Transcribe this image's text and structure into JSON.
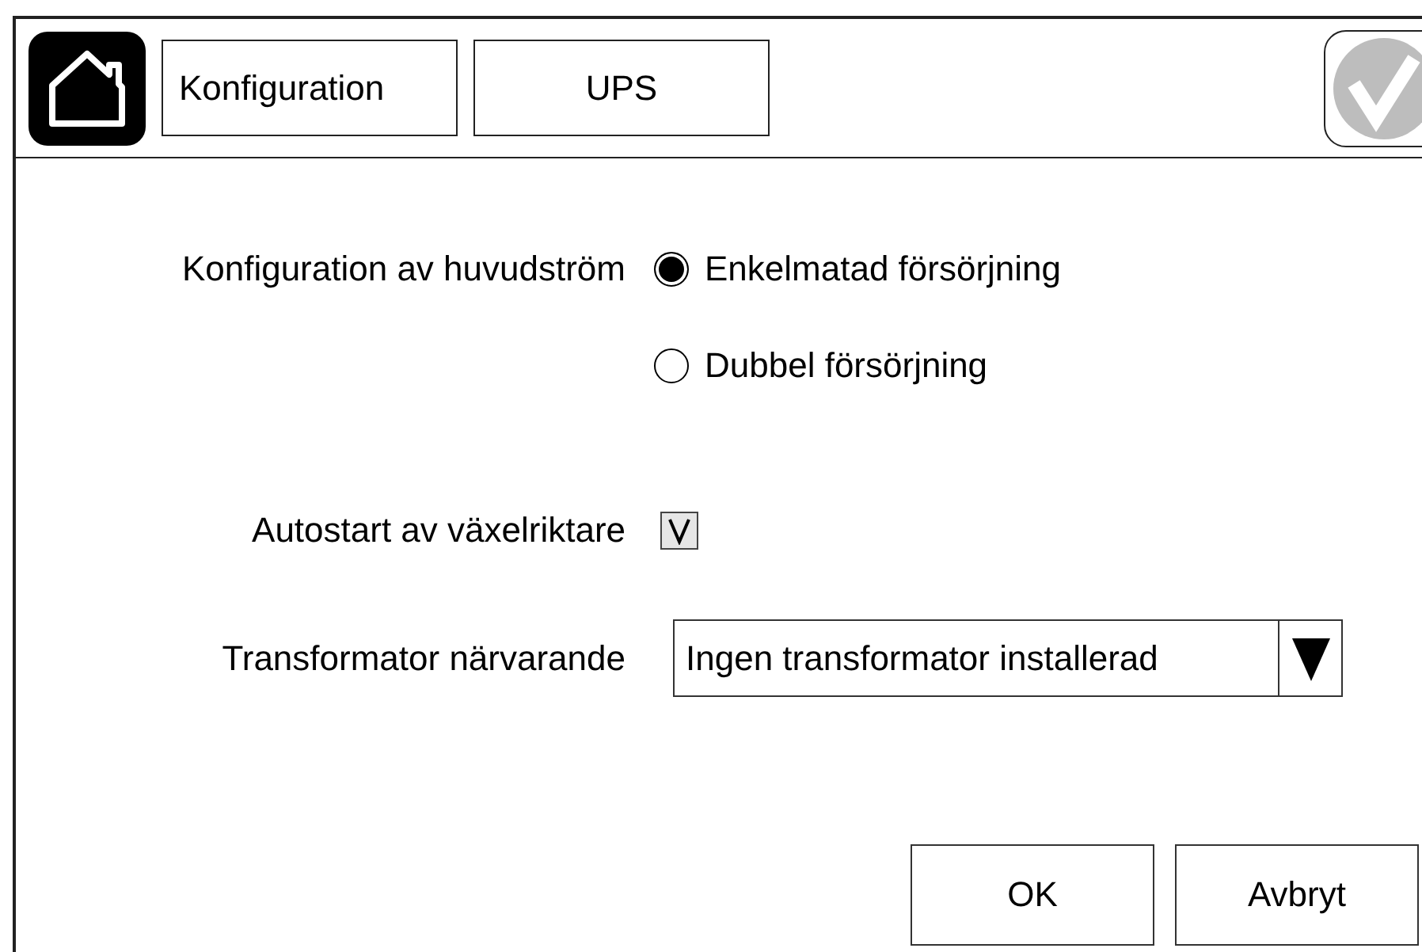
{
  "breadcrumbs": [
    {
      "label": "Konfiguration"
    },
    {
      "label": "UPS"
    }
  ],
  "main_power": {
    "label": "Konfiguration av huvudström",
    "options": [
      {
        "label": "Enkelmatad försörjning",
        "selected": true
      },
      {
        "label": "Dubbel försörjning",
        "selected": false
      }
    ]
  },
  "autostart": {
    "label": "Autostart av växelriktare",
    "checked": true
  },
  "transformer": {
    "label": "Transformator närvarande",
    "value": "Ingen transformator installerad"
  },
  "buttons": [
    {
      "label": "OK"
    },
    {
      "label": "Avbryt"
    }
  ]
}
